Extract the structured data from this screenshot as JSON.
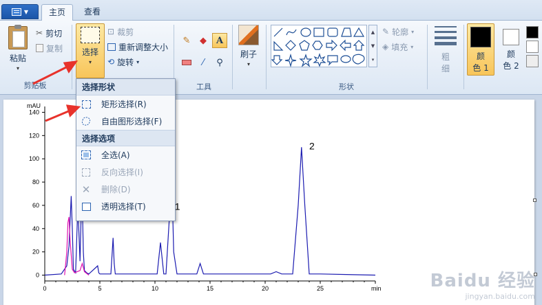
{
  "tabs": {
    "home": "主页",
    "view": "查看"
  },
  "clipboard": {
    "paste": "粘贴",
    "cut": "剪切",
    "copy": "复制",
    "group": "剪贴板"
  },
  "image": {
    "select": "选择",
    "crop": "裁剪",
    "resize": "重新调整大小",
    "rotate": "旋转"
  },
  "tools": {
    "group": "工具"
  },
  "brushes": {
    "label": "刷子"
  },
  "shapes": {
    "outline": "轮廓",
    "fill": "填充",
    "group": "形状"
  },
  "size": {
    "label_line1": "粗",
    "label_line2": "细"
  },
  "colors": {
    "color1_line1": "颜",
    "color1_line2": "色 1",
    "color2_line1": "颜",
    "color2_line2": "色 2",
    "color1_hex": "#000000",
    "color2_hex": "#ffffff",
    "palette": [
      "#000000",
      "#ffffff",
      "#ffffff"
    ]
  },
  "dropdown": {
    "shape_header": "选择形状",
    "rect": "矩形选择(R)",
    "freeform": "自由图形选择(F)",
    "options_header": "选择选项",
    "select_all": "全选(A)",
    "invert": "反向选择(I)",
    "delete": "删除(D)",
    "transparent": "透明选择(T)"
  },
  "chart_data": {
    "type": "line",
    "ylabel": "mAU",
    "xlabel": "min",
    "xlim": [
      0,
      30
    ],
    "ylim": [
      -5,
      145
    ],
    "yticks": [
      0,
      20,
      40,
      60,
      80,
      100,
      120,
      140
    ],
    "xticks": [
      0,
      5,
      10,
      15,
      20,
      25
    ],
    "annotations": [
      {
        "text": "1",
        "x": 11.8,
        "y": 56
      },
      {
        "text": "2",
        "x": 24.0,
        "y": 108
      }
    ],
    "series": [
      {
        "color": "#1a1ab0",
        "x": [
          0,
          1.5,
          2.0,
          2.2,
          2.4,
          2.5,
          2.6,
          2.8,
          3.0,
          3.2,
          3.3,
          3.4,
          3.5,
          3.6,
          3.8,
          4.0,
          4.8,
          4.9,
          5.0,
          6.0,
          6.2,
          6.3,
          6.4,
          6.6,
          7.0,
          10.2,
          10.5,
          10.8,
          11.0,
          11.3,
          11.5,
          11.7,
          12.0,
          13.8,
          14.1,
          14.4,
          15.0,
          20.5,
          21.0,
          21.5,
          22.5,
          23.0,
          23.3,
          23.6,
          24.0,
          25.0,
          30.0
        ],
        "y": [
          0,
          1,
          8,
          25,
          68,
          40,
          5,
          2,
          60,
          12,
          52,
          66,
          20,
          4,
          2,
          1,
          8,
          2,
          1,
          1,
          32,
          10,
          1,
          1,
          1,
          1,
          28,
          1,
          1,
          48,
          95,
          20,
          1,
          1,
          10,
          1,
          1,
          1,
          3,
          1,
          1,
          60,
          110,
          60,
          1,
          1,
          0
        ]
      },
      {
        "color": "#e010b0",
        "x": [
          1.8,
          2.0,
          2.1,
          2.2,
          2.3,
          2.5,
          2.7,
          3.2,
          3.4,
          3.6,
          4.0
        ],
        "y": [
          0,
          20,
          45,
          50,
          30,
          5,
          2,
          4,
          10,
          3,
          0
        ]
      }
    ]
  },
  "watermark": {
    "brand": "Baidu 经验",
    "url": "jingyan.baidu.com"
  }
}
